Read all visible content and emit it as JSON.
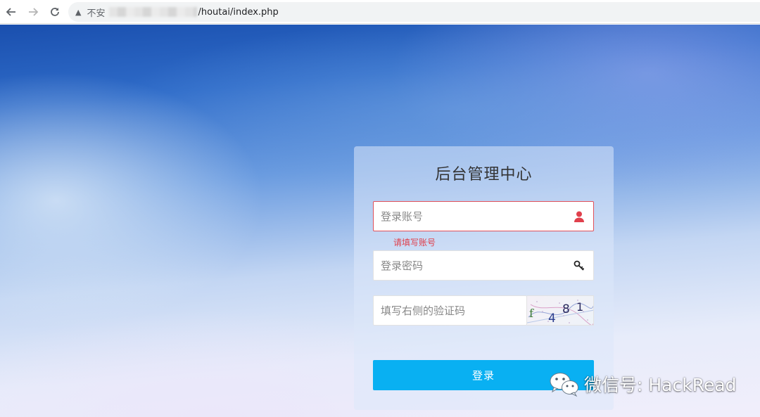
{
  "browser": {
    "back_icon": "back-arrow-icon",
    "forward_icon": "forward-arrow-icon",
    "reload_icon": "reload-icon",
    "security_label": "不安",
    "url_path": "/houtai/index.php"
  },
  "login": {
    "title": "后台管理中心",
    "username": {
      "placeholder": "登录账号",
      "value": "",
      "error": "请填写账号",
      "icon": "user-icon"
    },
    "password": {
      "placeholder": "登录密码",
      "value": "",
      "icon": "key-icon"
    },
    "captcha": {
      "placeholder": "填写右侧的验证码",
      "value": "",
      "image_text": [
        "f",
        "4",
        "8",
        "1"
      ]
    },
    "submit_label": "登录"
  },
  "watermark": {
    "text": "微信号: HackRead",
    "icon": "wechat-icon"
  },
  "colors": {
    "accent": "#09b0f2",
    "error": "#e0404c",
    "user_icon": "#e0404c"
  }
}
